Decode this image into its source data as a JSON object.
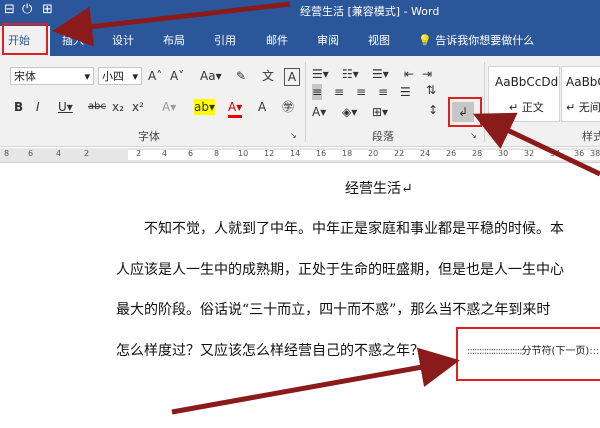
{
  "title": "经营生活 [兼容模式] - Word",
  "tabs": [
    "开始",
    "插入",
    "设计",
    "布局",
    "引用",
    "邮件",
    "审阅",
    "视图"
  ],
  "tell_me": "告诉我你想要做什么",
  "font": {
    "name": "宋体",
    "size": "小四"
  },
  "groups": {
    "font": "字体",
    "paragraph": "段落",
    "styles": "样式"
  },
  "styles": [
    {
      "preview": "AaBbCcDd",
      "name": "↵ 正文"
    },
    {
      "preview": "AaBbCcDd",
      "name": "↵ 无间"
    }
  ],
  "ruler_ticks": [
    "8",
    "6",
    "4",
    "2",
    "2",
    "4",
    "6",
    "8",
    "10",
    "12",
    "14",
    "16",
    "18",
    "20",
    "22",
    "24",
    "26",
    "28",
    "30",
    "32",
    "34",
    "36",
    "38"
  ],
  "document": {
    "heading": "经营生活↵",
    "lines": [
      "不知不觉，人就到了中年。中年正是家庭和事业都是平稳的时候。本",
      "人应该是人一生中的成熟期，正处于生命的旺盛期，但是也是人一生中心",
      "最大的阶段。俗话说“三十而立，四十而不惑”，那么当不惑之年到来时",
      "怎么样度过？又应该怎么样经营自己的不惑之年？"
    ],
    "section_break": "分节符(下一页)"
  },
  "colors": {
    "accent": "#2b579a",
    "highlight": "#e02020",
    "arrow": "#8b1a1a"
  }
}
